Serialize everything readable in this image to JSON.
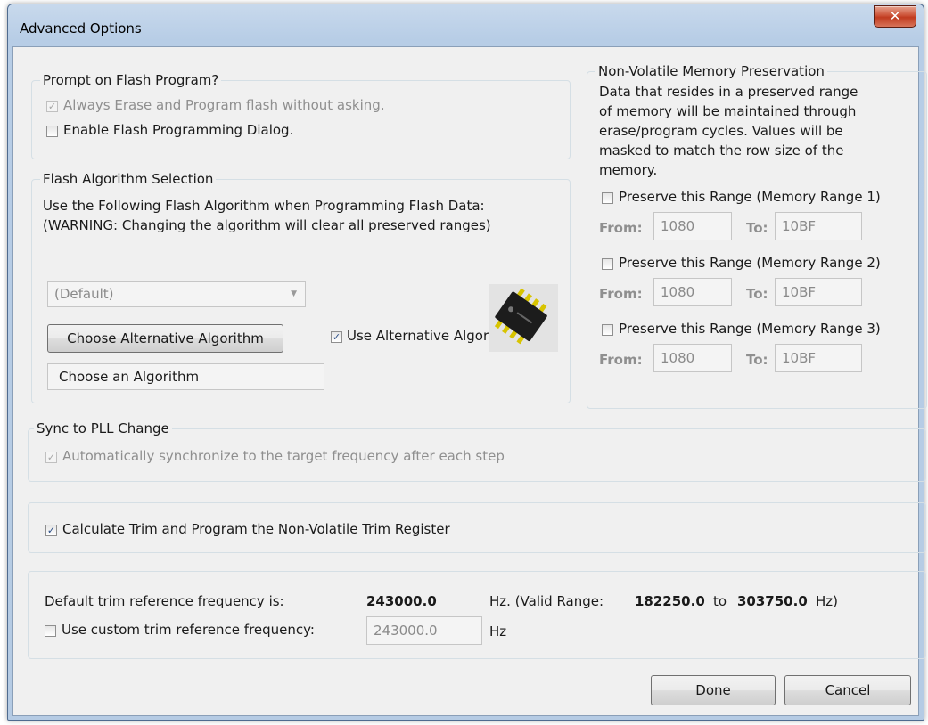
{
  "window": {
    "title": "Advanced Options",
    "close_glyph": "✕"
  },
  "flash_prompt": {
    "legend": "Prompt on Flash Program?",
    "always_erase": {
      "label": "Always Erase and Program flash without asking.",
      "checked": true,
      "enabled": false
    },
    "enable_dialog": {
      "label": "Enable Flash Programming Dialog.",
      "checked": false
    }
  },
  "flash_algorithm": {
    "legend": "Flash Algorithm Selection",
    "description_line1": "Use the Following Flash Algorithm when Programming Flash Data:",
    "description_line2": "(WARNING: Changing the algorithm will clear all preserved ranges)",
    "select_value": "(Default)",
    "choose_button": "Choose Alternative Algorithm",
    "use_alternative": {
      "label": "Use Alternative Algorithm",
      "checked": true
    },
    "algorithm_field": "Choose an Algorithm",
    "chip_icon": "ic-chip-icon"
  },
  "memory_preservation": {
    "legend": "Non-Volatile Memory Preservation",
    "description": [
      "Data that resides in a preserved range",
      "of memory will be maintained through",
      "erase/program cycles. Values will be",
      "masked to match the row size of the",
      "memory."
    ],
    "ranges": [
      {
        "label": "Preserve this Range (Memory Range 1)",
        "checked": false,
        "from_label": "From:",
        "from": "1080",
        "to_label": "To:",
        "to": "10BF"
      },
      {
        "label": "Preserve this Range (Memory Range 2)",
        "checked": false,
        "from_label": "From:",
        "from": "1080",
        "to_label": "To:",
        "to": "10BF"
      },
      {
        "label": "Preserve this Range (Memory Range 3)",
        "checked": false,
        "from_label": "From:",
        "from": "1080",
        "to_label": "To:",
        "to": "10BF"
      }
    ]
  },
  "sync_pll": {
    "legend": "Sync to PLL Change",
    "auto_sync": {
      "label": "Automatically synchronize to the target frequency after each step",
      "checked": true,
      "enabled": false
    }
  },
  "trim": {
    "calculate": {
      "label": "Calculate Trim and Program the Non-Volatile Trim Register",
      "checked": true
    },
    "default_label": "Default trim reference frequency is:",
    "default_value": "243000.0",
    "valid_prefix": "Hz. (Valid Range:",
    "range_min": "182250.0",
    "range_to": "to",
    "range_max": "303750.0",
    "range_suffix": "Hz)",
    "custom": {
      "label": "Use custom trim reference frequency:",
      "checked": false
    },
    "custom_value": "243000.0",
    "custom_unit": "Hz"
  },
  "buttons": {
    "done": "Done",
    "cancel": "Cancel"
  }
}
